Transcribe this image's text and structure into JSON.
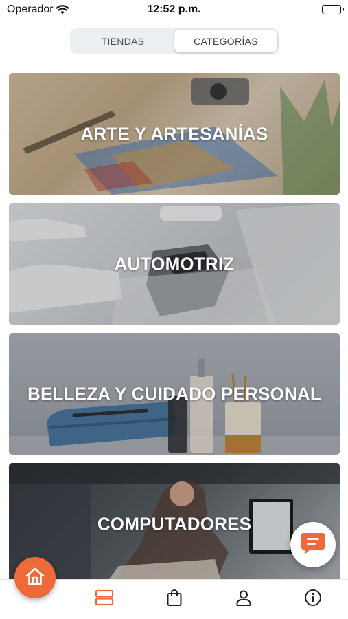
{
  "status_bar": {
    "carrier": "Operador",
    "time": "12:52 p.m.",
    "icons": [
      "wifi-icon",
      "battery-icon"
    ]
  },
  "segment": {
    "tabs": [
      {
        "label": "TIENDAS",
        "active": false
      },
      {
        "label": "CATEGORÍAS",
        "active": true
      }
    ]
  },
  "categories": [
    {
      "title": "ARTE Y ARTESANÍAS"
    },
    {
      "title": "AUTOMOTRIZ"
    },
    {
      "title": "BELLEZA Y CUIDADO PERSONAL"
    },
    {
      "title": "COMPUTADORES"
    }
  ],
  "tabbar": {
    "items": [
      {
        "icon": "home-icon",
        "active": false
      },
      {
        "icon": "categories-icon",
        "active": true
      },
      {
        "icon": "shopping-bag-icon",
        "active": false
      },
      {
        "icon": "user-icon",
        "active": false
      },
      {
        "icon": "info-icon",
        "active": false
      }
    ]
  },
  "floating": {
    "chat_icon": "chat-icon"
  },
  "colors": {
    "accent": "#ef6a3b",
    "segment_bg": "#eceff1",
    "icon_gray": "#222222"
  }
}
